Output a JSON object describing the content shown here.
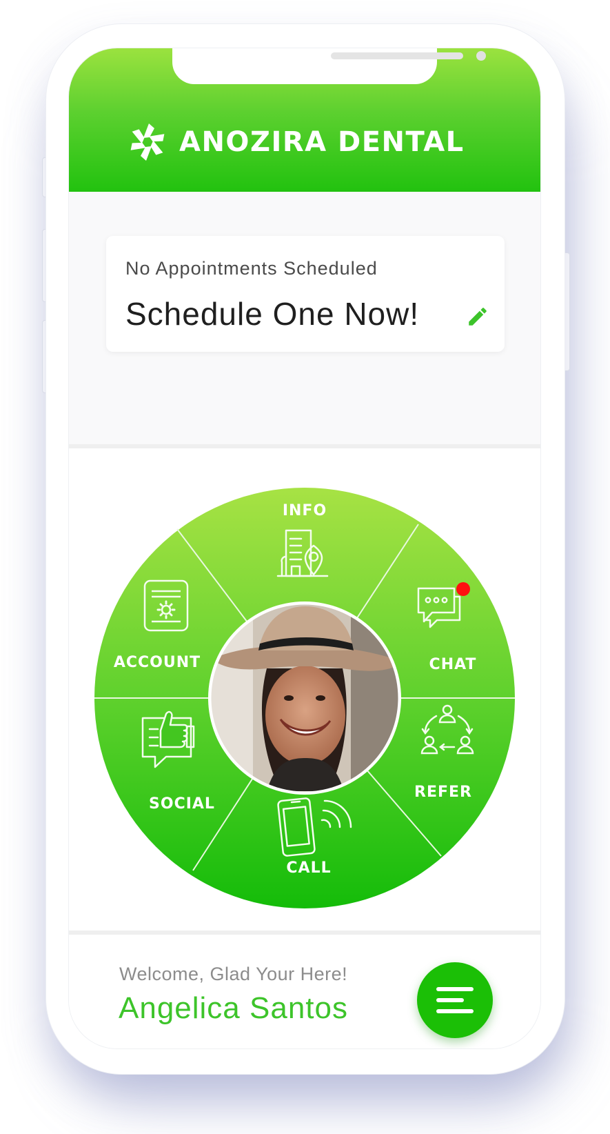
{
  "brand": {
    "name": "ANOZIRA DENTAL",
    "logo_icon": "aperture-logo-icon"
  },
  "appointment": {
    "status": "No Appointments Scheduled",
    "cta": "Schedule One Now!",
    "edit_icon": "pencil-icon"
  },
  "wheel": {
    "center_icon": "avatar",
    "notification_dot": true,
    "items": [
      {
        "label": "INFO",
        "icon": "building-location-icon"
      },
      {
        "label": "CHAT",
        "icon": "chat-bubbles-icon"
      },
      {
        "label": "REFER",
        "icon": "referral-cycle-icon"
      },
      {
        "label": "CALL",
        "icon": "phone-call-icon"
      },
      {
        "label": "SOCIAL",
        "icon": "thumbs-up-bubble-icon"
      },
      {
        "label": "ACCOUNT",
        "icon": "account-settings-icon"
      }
    ]
  },
  "footer": {
    "welcome": "Welcome, Glad Your Here!",
    "user_name": "Angelica Santos",
    "menu_icon": "menu-icon"
  },
  "colors": {
    "header_top": "#9be23f",
    "header_bottom": "#22c20f",
    "wheel_top": "#a4e142",
    "wheel_bottom": "#16bd0a",
    "accent": "#3dc42a",
    "notification": "#ff1010"
  }
}
